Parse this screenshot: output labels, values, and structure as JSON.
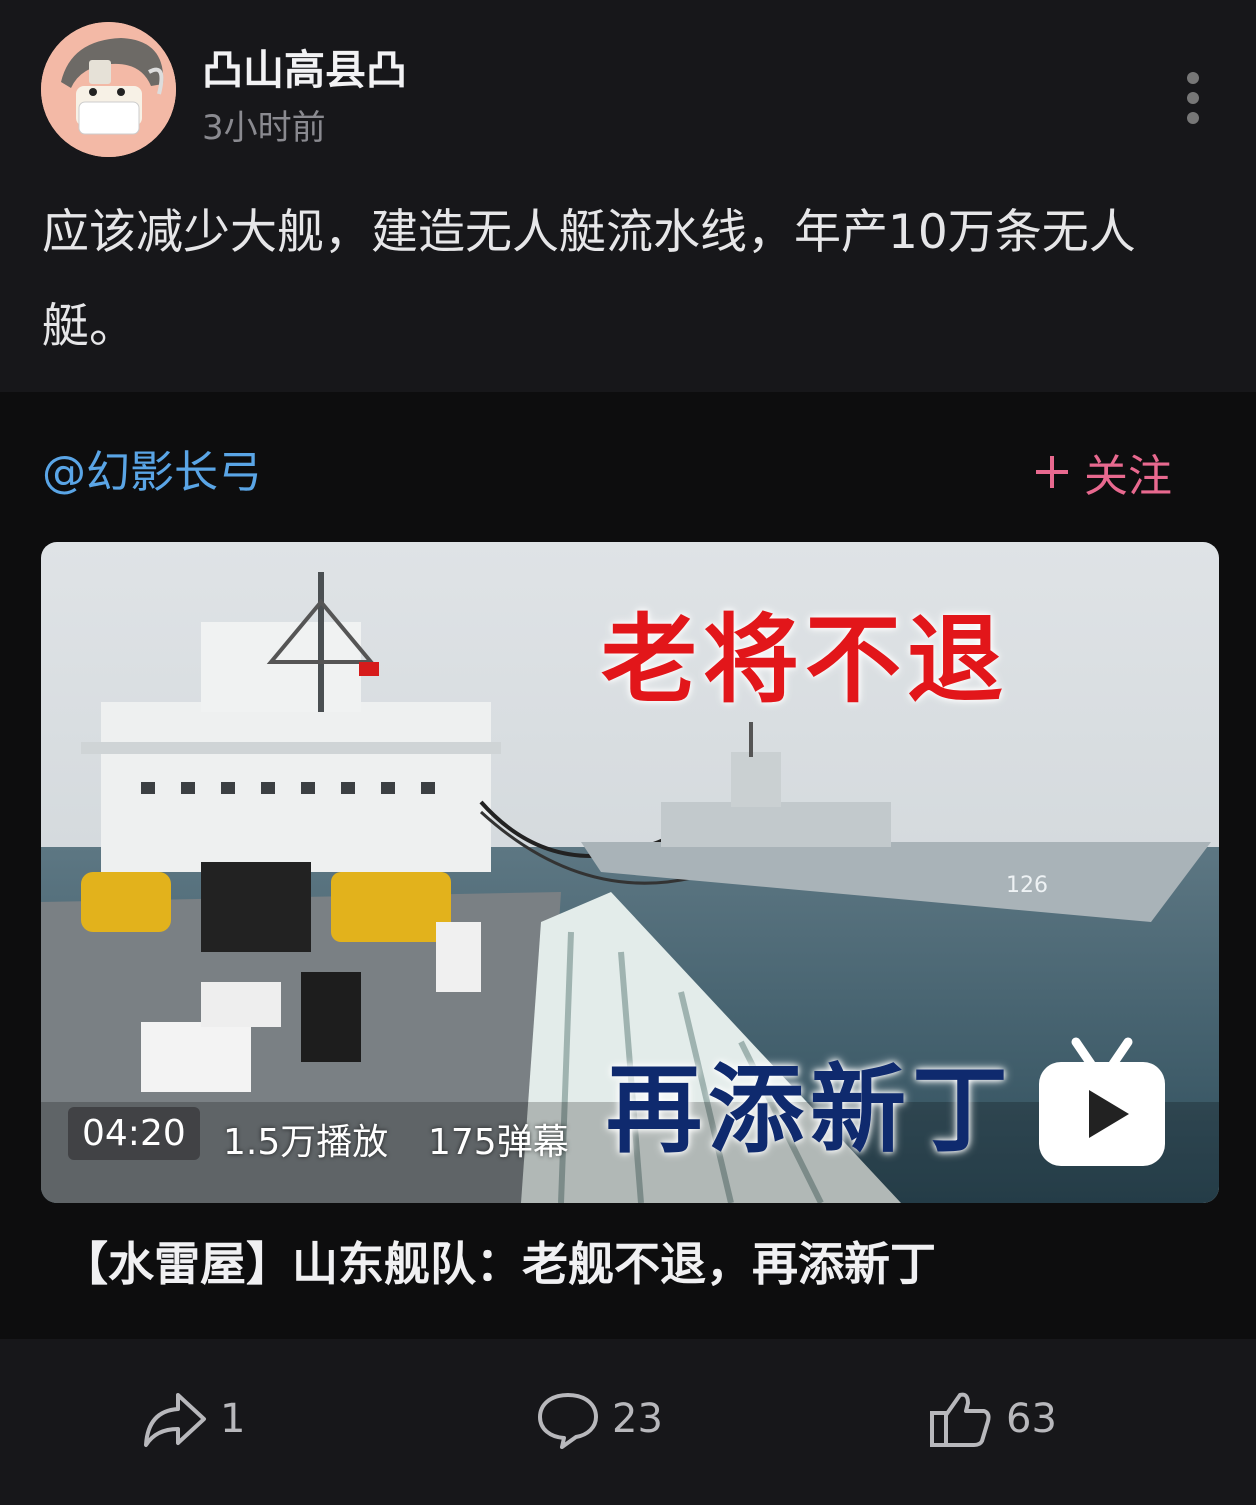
{
  "post": {
    "author": "凸山高县凸",
    "time": "3小时前",
    "text": "应该减少大舰，建造无人艇流水线，年产10万条无人艇。"
  },
  "embed": {
    "up_name": "@幻影长弓",
    "follow_label": "关注",
    "thumbnail": {
      "headline_top": "老将不退",
      "headline_bottom": "再添新丁",
      "hull_number": "126",
      "duration": "04:20",
      "plays": "1.5万播放",
      "danmaku": "175弹幕"
    },
    "video_title": "【水雷屋】山东舰队：老舰不退，再添新丁"
  },
  "actions": {
    "share_count": "1",
    "comment_count": "23",
    "like_count": "63"
  },
  "colors": {
    "background": "#17171a",
    "embed_background": "#0d0d0e",
    "link": "#5aa5e6",
    "follow": "#e8698f",
    "headline_red": "#e2161a",
    "headline_navy": "#0f2a6e"
  },
  "icons": [
    "more-vertical-icon",
    "plus-icon",
    "tv-play-icon",
    "share-icon",
    "comment-icon",
    "like-icon"
  ]
}
